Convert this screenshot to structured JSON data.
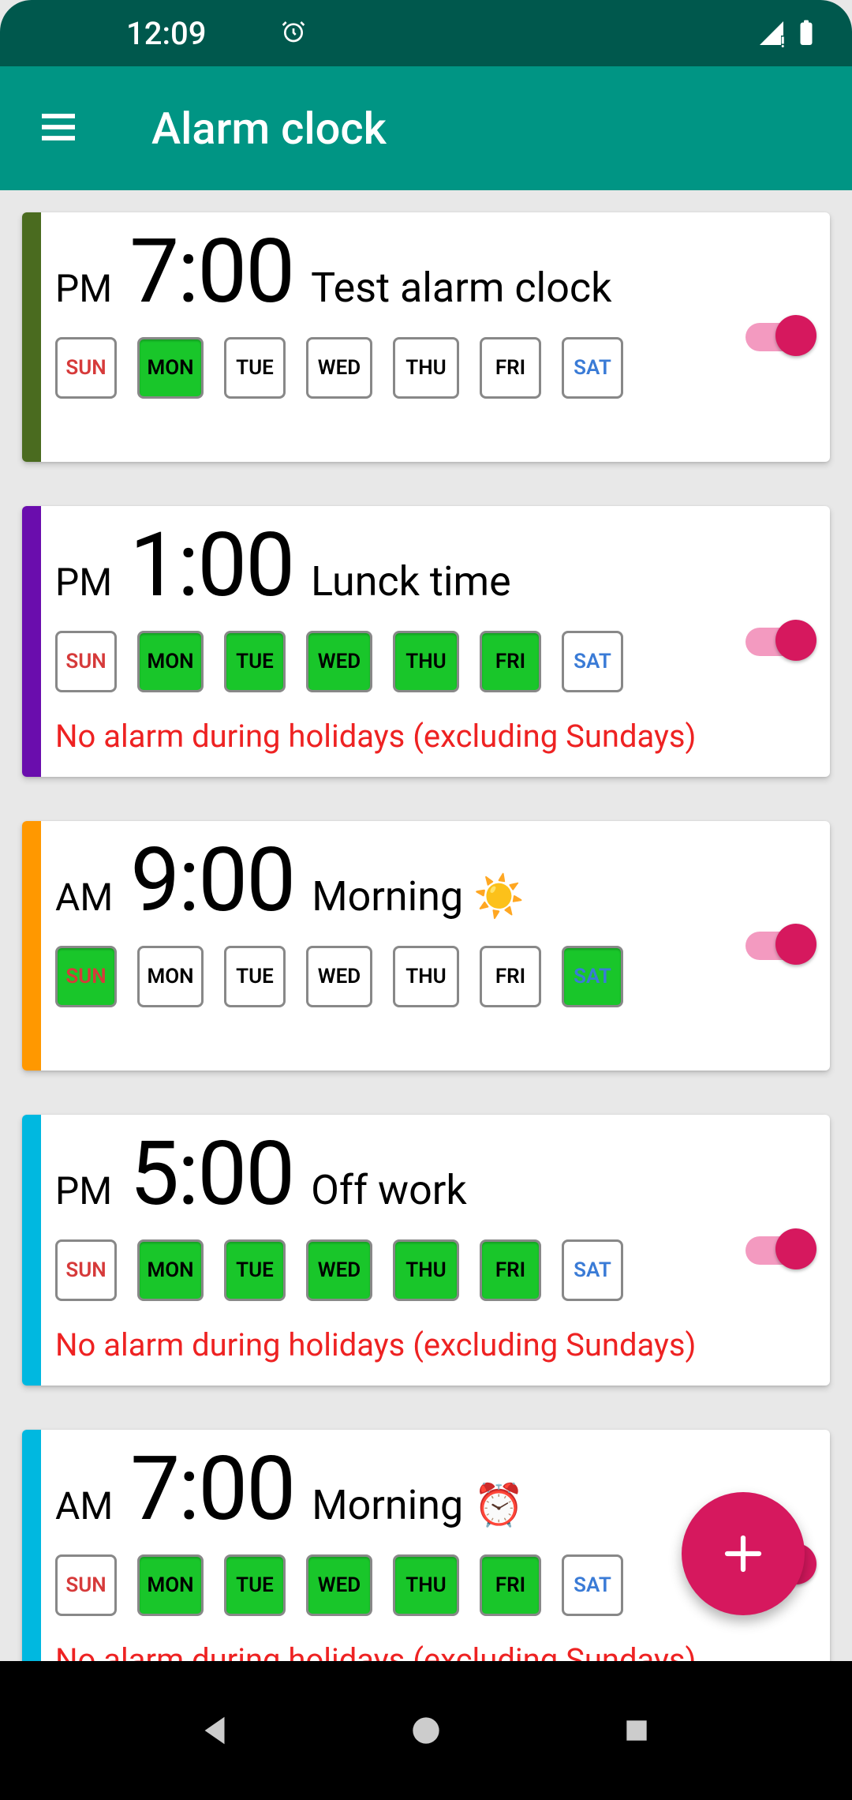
{
  "status": {
    "time": "12:09"
  },
  "app": {
    "title": "Alarm clock"
  },
  "dayLabels": [
    "SUN",
    "MON",
    "TUE",
    "WED",
    "THU",
    "FRI",
    "SAT"
  ],
  "alarms": [
    {
      "ampm": "PM",
      "time": "7:00",
      "label": "Test alarm clock",
      "barColor": "#4a6b1f",
      "days": [
        false,
        true,
        false,
        false,
        false,
        false,
        false
      ],
      "enabled": true,
      "note": ""
    },
    {
      "ampm": "PM",
      "time": "1:00",
      "label": "Lunck time",
      "barColor": "#6a0dad",
      "days": [
        false,
        true,
        true,
        true,
        true,
        true,
        false
      ],
      "enabled": true,
      "note": "No alarm during holidays (excluding Sundays)"
    },
    {
      "ampm": "AM",
      "time": "9:00",
      "label": "Morning ☀️",
      "barColor": "#ff9800",
      "days": [
        true,
        false,
        false,
        false,
        false,
        false,
        true
      ],
      "enabled": true,
      "note": ""
    },
    {
      "ampm": "PM",
      "time": "5:00",
      "label": "Off work",
      "barColor": "#00b8e0",
      "days": [
        false,
        true,
        true,
        true,
        true,
        true,
        false
      ],
      "enabled": true,
      "note": "No alarm during holidays (excluding Sundays)"
    },
    {
      "ampm": "AM",
      "time": "7:00",
      "label": "Morning ⏰",
      "barColor": "#00b8e0",
      "days": [
        false,
        true,
        true,
        true,
        true,
        true,
        false
      ],
      "enabled": true,
      "note": "No alarm during holidays (excluding Sundays)"
    }
  ]
}
